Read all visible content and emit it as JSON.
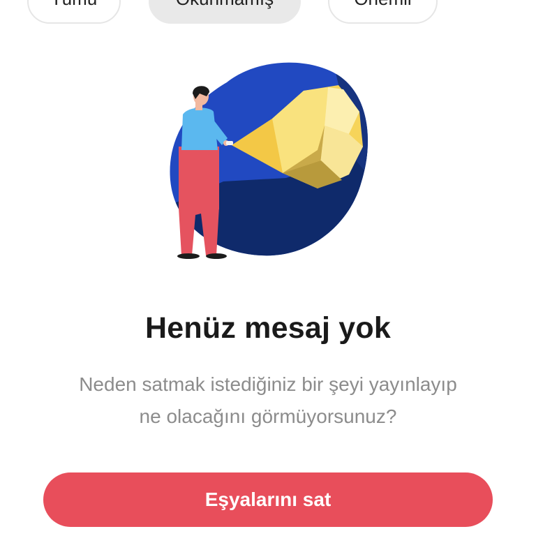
{
  "filters": {
    "all_label": "Tümü",
    "unread_label": "Okunmamış",
    "important_label": "Önemli",
    "active": "unread"
  },
  "empty_state": {
    "title": "Henüz mesaj yok",
    "subtitle_line1": "Neden satmak istediğiniz bir şeyi yayınlayıp",
    "subtitle_line2": "ne olacağını görmüyorsunuz?",
    "illustration": "person-with-flashlight-illustration"
  },
  "cta": {
    "label": "Eşyalarını sat",
    "color": "#e84e5b"
  },
  "colors": {
    "blob_blue": "#2149c1",
    "blob_navy": "#0f2a6b",
    "light_yellow": "#f8e27a",
    "shirt_blue": "#5bb8ef",
    "pants_red": "#e5535f"
  }
}
